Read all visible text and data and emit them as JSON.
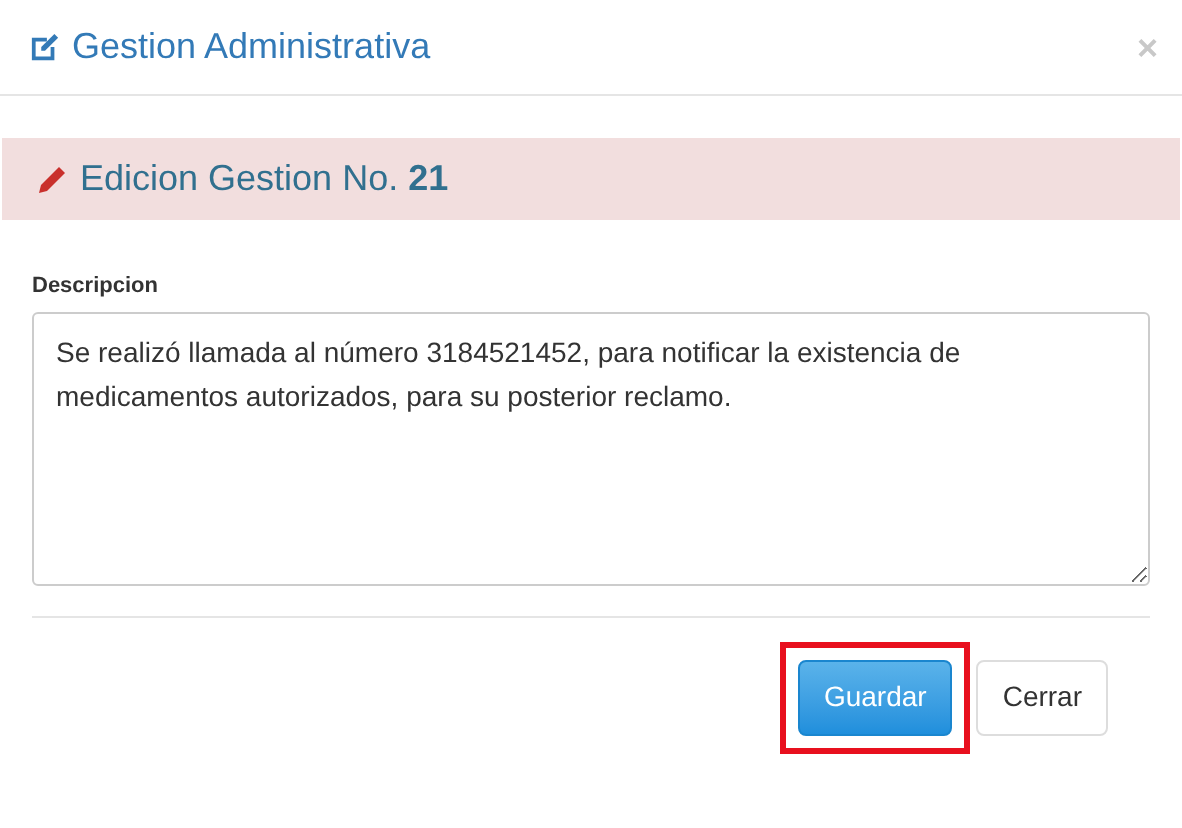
{
  "window": {
    "title": "Gestion Administrativa",
    "close": "×"
  },
  "alert": {
    "text": "Edicion Gestion No. **21**"
  },
  "description": {
    "label": "Descripcion",
    "value": "Se realizó llamada al número 3184521452, para notificar la existencia de medicamentos autorizados, para su posterior reclamo."
  },
  "buttons": [
    {
      "label": "Guardar",
      "kind": "primary",
      "highlighted": true
    },
    {
      "label": "Cerrar",
      "kind": "default",
      "highlighted": false
    }
  ]
}
